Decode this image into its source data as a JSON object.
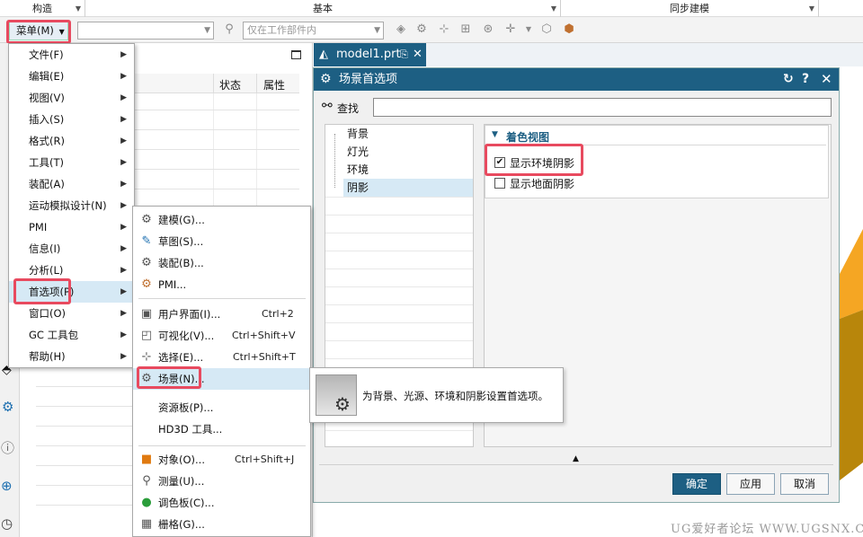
{
  "ribbon": {
    "groups": [
      "构造",
      "基本",
      "同步建模"
    ]
  },
  "toolbar": {
    "menu_button": "菜单(M)",
    "combo1_value": "",
    "filter_value": "仅在工作部件内"
  },
  "menu": {
    "items": [
      {
        "label": "文件(F)",
        "has_sub": true
      },
      {
        "label": "编辑(E)",
        "has_sub": true
      },
      {
        "label": "视图(V)",
        "has_sub": true
      },
      {
        "label": "插入(S)",
        "has_sub": true
      },
      {
        "label": "格式(R)",
        "has_sub": true
      },
      {
        "label": "工具(T)",
        "has_sub": true
      },
      {
        "label": "装配(A)",
        "has_sub": true
      },
      {
        "label": "运动模拟设计(N)",
        "has_sub": true
      },
      {
        "label": "PMI",
        "has_sub": true
      },
      {
        "label": "信息(I)",
        "has_sub": true
      },
      {
        "label": "分析(L)",
        "has_sub": true
      },
      {
        "label": "首选项(P)",
        "has_sub": true
      },
      {
        "label": "窗口(O)",
        "has_sub": true
      },
      {
        "label": "GC 工具包",
        "has_sub": true
      },
      {
        "label": "帮助(H)",
        "has_sub": true
      }
    ]
  },
  "submenu": {
    "items": [
      {
        "label": "建模(G)...",
        "shortcut": "",
        "icon": "modeling-gear-icon"
      },
      {
        "label": "草图(S)...",
        "shortcut": "",
        "icon": "sketch-gear-icon"
      },
      {
        "label": "装配(B)...",
        "shortcut": "",
        "icon": "assembly-gear-icon"
      },
      {
        "label": "PMI...",
        "shortcut": "",
        "icon": "pmi-gear-icon"
      },
      {
        "label": "用户界面(I)...",
        "shortcut": "Ctrl+2",
        "icon": "ui-gear-icon"
      },
      {
        "label": "可视化(V)...",
        "shortcut": "Ctrl+Shift+V",
        "icon": "visualization-gear-icon"
      },
      {
        "label": "选择(E)...",
        "shortcut": "Ctrl+Shift+T",
        "icon": "selection-gear-icon"
      },
      {
        "label": "场景(N)...",
        "shortcut": "",
        "icon": "scene-gear-icon"
      },
      {
        "label": "资源板(P)...",
        "shortcut": "",
        "icon": ""
      },
      {
        "label": "HD3D 工具...",
        "shortcut": "",
        "icon": ""
      },
      {
        "label": "对象(O)...",
        "shortcut": "Ctrl+Shift+J",
        "icon": "object-gear-icon"
      },
      {
        "label": "测量(U)...",
        "shortcut": "",
        "icon": "measure-gear-icon"
      },
      {
        "label": "调色板(C)...",
        "shortcut": "",
        "icon": "palette-gear-icon"
      },
      {
        "label": "栅格(G)...",
        "shortcut": "",
        "icon": "grid-gear-icon"
      }
    ]
  },
  "navigator": {
    "col_status": "状态",
    "col_property": "属性"
  },
  "tab": {
    "label": "model1.prt"
  },
  "dialog": {
    "title": "场景首选项",
    "search_label": "查找",
    "search_value": "",
    "tree": [
      "背景",
      "灯光",
      "环境",
      "阴影"
    ],
    "section_title": "着色视图",
    "opt1": "显示环境阴影",
    "opt1_checked": true,
    "opt2": "显示地面阴影",
    "opt2_checked": false,
    "ok": "确定",
    "apply": "应用",
    "cancel": "取消"
  },
  "tooltip": {
    "text": "为背景、光源、环境和阴影设置首选项。"
  },
  "watermark": "UG爱好者论坛 WWW.UGSNX.COM",
  "colors": {
    "accent": "#1d5f83",
    "highlight": "#e84a5f",
    "selected": "#d6e9f5",
    "model_orange": "#f5a623"
  }
}
